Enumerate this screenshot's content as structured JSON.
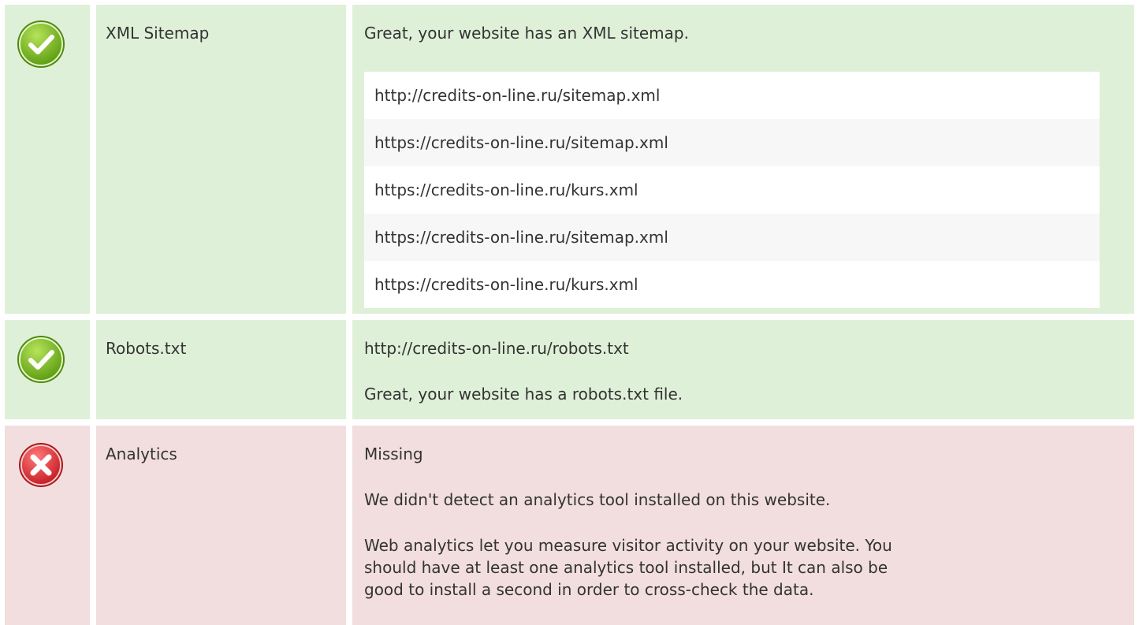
{
  "checks": [
    {
      "status": "pass",
      "status_icon": "check-icon",
      "label": "XML Sitemap",
      "message": "Great, your website has an XML sitemap.",
      "urls": [
        "http://credits-on-line.ru/sitemap.xml",
        "https://credits-on-line.ru/sitemap.xml",
        "https://credits-on-line.ru/kurs.xml",
        "https://credits-on-line.ru/sitemap.xml",
        "https://credits-on-line.ru/kurs.xml"
      ]
    },
    {
      "status": "pass",
      "status_icon": "check-icon",
      "label": "Robots.txt",
      "url": "http://credits-on-line.ru/robots.txt",
      "message": "Great, your website has a robots.txt file."
    },
    {
      "status": "fail",
      "status_icon": "cross-icon",
      "label": "Analytics",
      "state": "Missing",
      "message": "We didn't detect an analytics tool installed on this website.",
      "advice_lines": [
        "Web analytics let you measure visitor activity on your website. You",
        "should have at least one analytics tool installed, but It can also be",
        "good to install a second in order to cross-check the data."
      ]
    }
  ],
  "colors": {
    "pass_bg": "#dff0d8",
    "fail_bg": "#f2dede",
    "pass_icon": "#7cbf1e",
    "fail_icon": "#e0343a",
    "text": "#333333"
  }
}
